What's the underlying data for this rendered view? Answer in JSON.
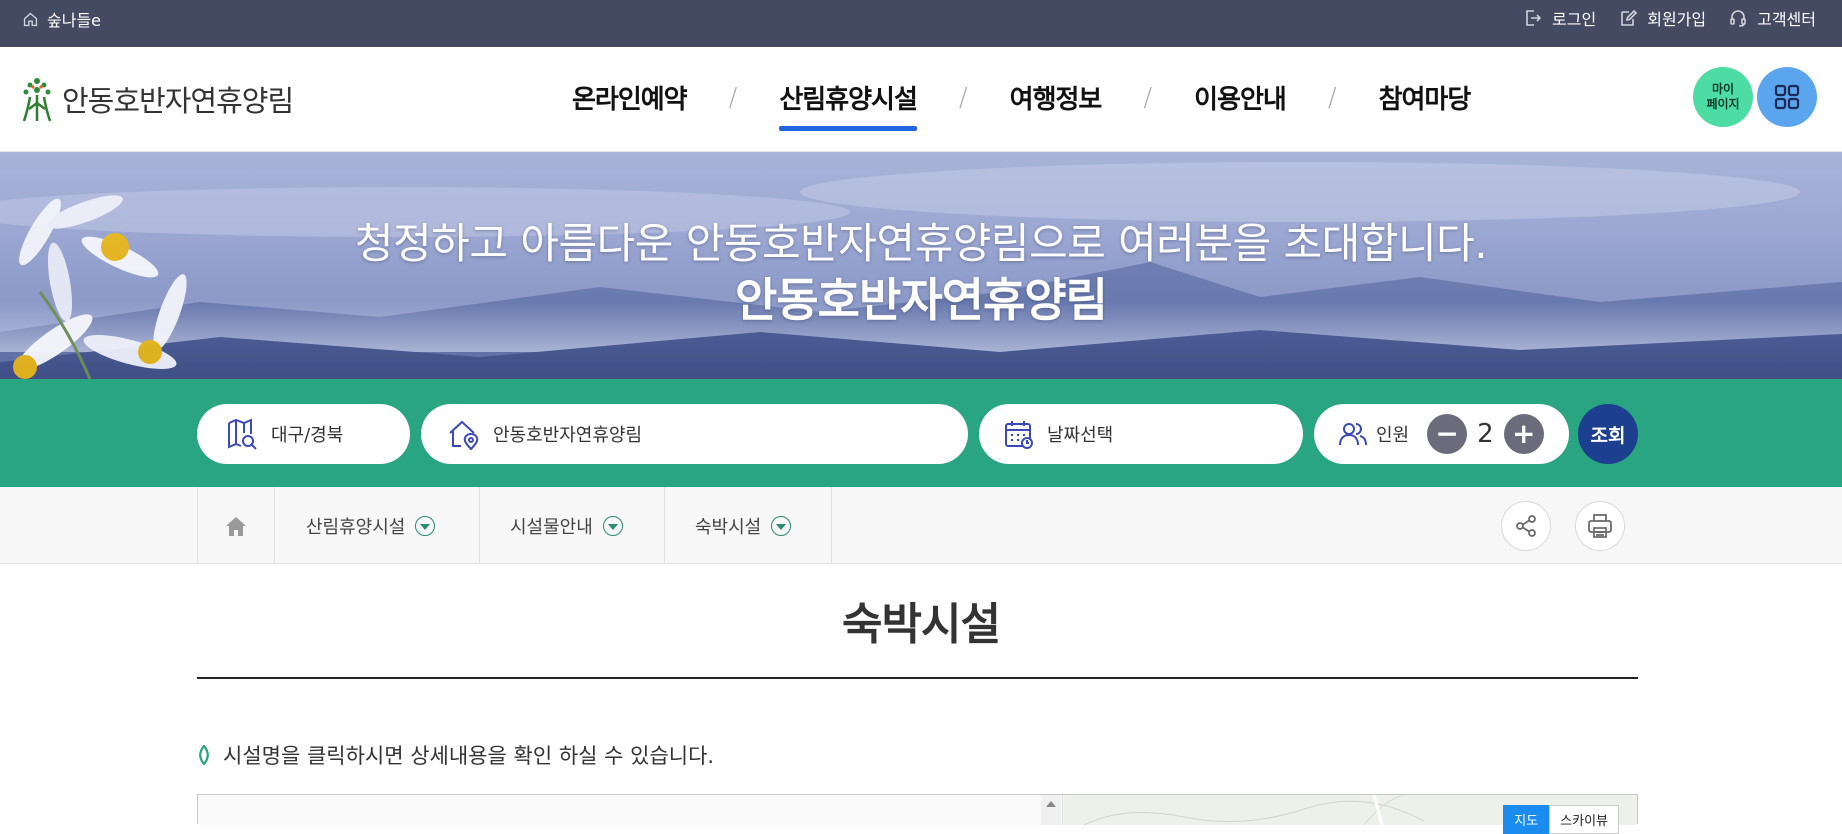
{
  "topbar": {
    "home_label": "숲나들e",
    "login": "로그인",
    "join": "회원가입",
    "support": "고객센터"
  },
  "header": {
    "logo_text": "안동호반자연휴양림",
    "nav": [
      "온라인예약",
      "산림휴양시설",
      "여행정보",
      "이용안내",
      "참여마당"
    ],
    "nav_separator": "/",
    "active_nav_index": 1,
    "mypage_label": [
      "마이",
      "페이지"
    ]
  },
  "banner": {
    "line1": "청정하고 아름다운 안동호반자연휴양림으로 여러분을 초대합니다.",
    "line2": "안동호반자연휴양림"
  },
  "search": {
    "region": "대구/경북",
    "facility": "안동호반자연휴양림",
    "date": "날짜선택",
    "people_label": "인원",
    "people_count": "2",
    "minus": "−",
    "plus": "+",
    "submit": "조회"
  },
  "breadcrumb": {
    "items": [
      "산림휴양시설",
      "시설물안내",
      "숙박시설"
    ]
  },
  "content": {
    "title": "숙박시설",
    "notice": "시설명을 클릭하시면 상세내용을 확인 하실 수 있습니다.",
    "map_types": [
      "지도",
      "스카이뷰"
    ]
  },
  "colors": {
    "topbar": "#434a62",
    "nav_active": "#1f66e0",
    "search_bg": "#2aa582",
    "submit_bg": "#1c3f8f",
    "mypage_bg": "#4ddca3",
    "allmenu_bg": "#5aa5ee"
  }
}
